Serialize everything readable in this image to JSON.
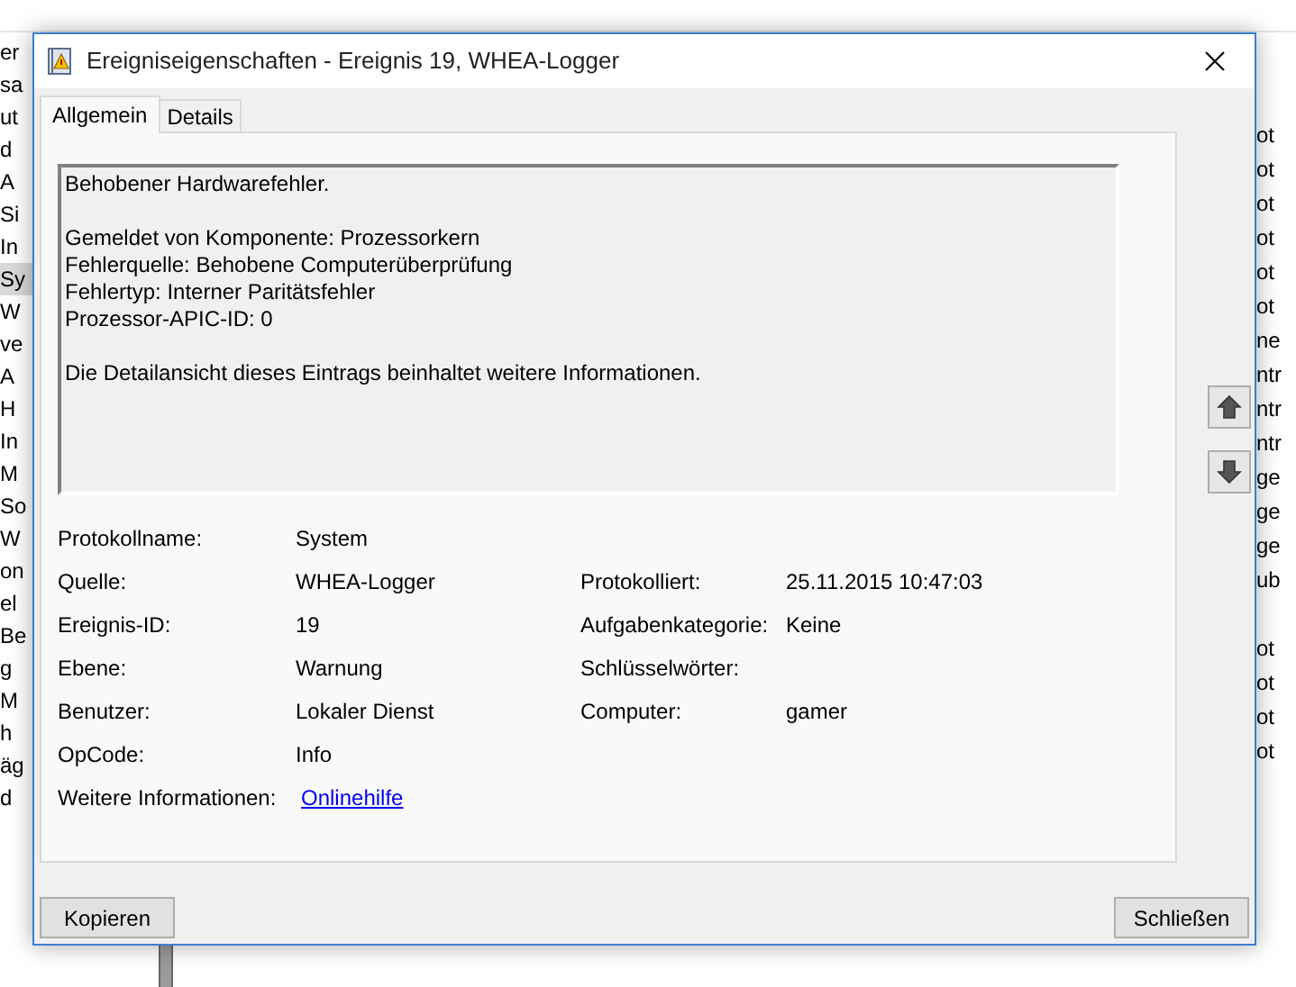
{
  "background": {
    "left_fragments": [
      {
        "text": "er",
        "selected": false
      },
      {
        "text": "sa",
        "selected": false
      },
      {
        "text": "ut",
        "selected": false
      },
      {
        "text": "d",
        "selected": false
      },
      {
        "text": "A",
        "selected": false
      },
      {
        "text": "Si",
        "selected": false
      },
      {
        "text": "In",
        "selected": false
      },
      {
        "text": "Sy",
        "selected": true
      },
      {
        "text": "W",
        "selected": false
      },
      {
        "text": "ve",
        "selected": false
      },
      {
        "text": "A",
        "selected": false
      },
      {
        "text": "H",
        "selected": false
      },
      {
        "text": "In",
        "selected": false
      },
      {
        "text": "M",
        "selected": false
      },
      {
        "text": "So",
        "selected": false
      },
      {
        "text": "W",
        "selected": false
      },
      {
        "text": "on",
        "selected": false
      },
      {
        "text": "el",
        "selected": false
      },
      {
        "text": "Be",
        "selected": false
      },
      {
        "text": "g",
        "selected": false
      },
      {
        "text": "M",
        "selected": false
      },
      {
        "text": "h",
        "selected": false
      },
      {
        "text": "äg",
        "selected": false
      },
      {
        "text": "d",
        "selected": false
      }
    ],
    "right_fragments_upper": [
      "ot",
      "ot",
      "ot",
      "ot",
      "ot",
      "ot",
      "ne",
      "ntr",
      "ntr",
      "ntr",
      "ge",
      "ge",
      "ge",
      "ub"
    ],
    "right_fragments_lower": [
      "ot",
      "ot",
      "ot",
      "ot"
    ]
  },
  "dialog": {
    "title": "Ereigniseigenschaften - Ereignis 19, WHEA-Logger",
    "tabs": [
      {
        "label": "Allgemein",
        "selected": true
      },
      {
        "label": "Details",
        "selected": false
      }
    ],
    "description": [
      [
        "Behobener Hardwarefehler."
      ],
      [
        "Gemeldet von Komponente: Prozessorkern",
        "Fehlerquelle: Behobene Computerüberprüfung",
        "Fehlertyp: Interner Paritätsfehler",
        "Prozessor-APIC-ID: 0"
      ],
      [
        "Die Detailansicht dieses Eintrags beinhaltet weitere Informationen."
      ]
    ],
    "properties": [
      {
        "label": "Protokollname:",
        "value": "System",
        "kind": "text"
      },
      {
        "label": "Quelle:",
        "value": "WHEA-Logger",
        "kind": "text",
        "right_label": "Protokolliert:",
        "right_value": "25.11.2015 10:47:03"
      },
      {
        "label": "Ereignis-ID:",
        "value": "19",
        "kind": "text",
        "right_label": "Aufgabenkategorie:",
        "right_value": "Keine"
      },
      {
        "label": "Ebene:",
        "value": "Warnung",
        "kind": "text",
        "right_label": "Schlüsselwörter:"
      },
      {
        "label": "Benutzer:",
        "value": "Lokaler Dienst",
        "kind": "text",
        "right_label": "Computer:",
        "right_value": "gamer"
      },
      {
        "label": "OpCode:",
        "value": "Info",
        "kind": "text"
      },
      {
        "label": "Weitere Informationen:",
        "value": "Onlinehilfe",
        "kind": "link"
      }
    ],
    "buttons": [
      "Kopieren",
      "Schließen"
    ]
  }
}
